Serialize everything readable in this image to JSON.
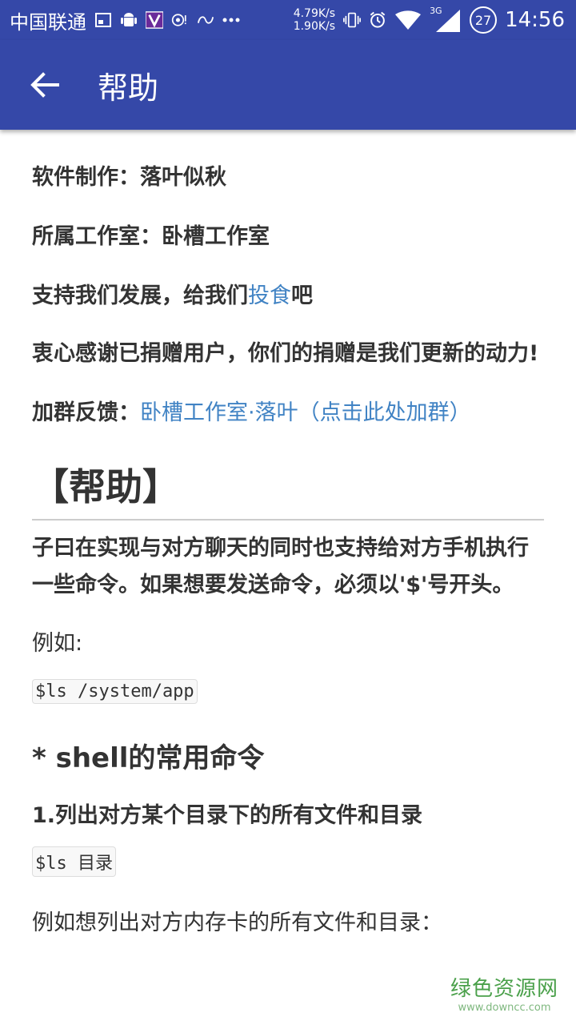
{
  "status_bar": {
    "carrier": "中国联通",
    "net_up": "4.79K/s",
    "net_down": "1.90K/s",
    "network_type": "3G",
    "notification_count": "27",
    "time": "14:56"
  },
  "app_bar": {
    "title": "帮助"
  },
  "info": {
    "author_label": "软件制作：",
    "author": "落叶似秋",
    "studio_label": "所属工作室：",
    "studio": "卧槽工作室",
    "support_prefix": "支持我们发展，给我们",
    "support_link": "投食",
    "support_suffix": "吧",
    "thanks": "衷心感谢已捐赠用户，你们的捐赠是我们更新的动力!",
    "group_label": "加群反馈：",
    "group_link": "卧槽工作室·落叶（点击此处加群）"
  },
  "help": {
    "title": "【帮助】",
    "intro": "子曰在实现与对方聊天的同时也支持给对方手机执行一些命令。如果想要发送命令，必须以'$'号开头。",
    "example_label": "例如:",
    "example_code": "$ls /system/app",
    "shell_title": "* shell的常用命令",
    "item1_title": "1.列出对方某个目录下的所有文件和目录",
    "item1_code_cmd": "$ls",
    "item1_code_arg": "目录",
    "item1_example": "例如想列出对方内存卡的所有文件和目录："
  },
  "watermark": {
    "main": "绿色资源网",
    "sub": "www.downcc.com"
  }
}
